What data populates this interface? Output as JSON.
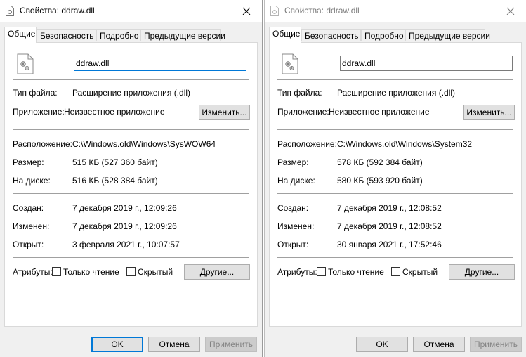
{
  "windows": [
    {
      "title": "Свойства: ddraw.dll",
      "tabs": [
        "Общие",
        "Безопасность",
        "Подробно",
        "Предыдущие версии"
      ],
      "file_name": "ddraw.dll",
      "file_type_label": "Тип файла:",
      "file_type_value": "Расширение приложения (.dll)",
      "app_label": "Приложение:",
      "app_value": "Неизвестное приложение",
      "change_button": "Изменить...",
      "location_label": "Расположение:",
      "location_value": "C:\\Windows.old\\Windows\\SysWOW64",
      "size_label": "Размер:",
      "size_value": "515 КБ (527 360 байт)",
      "disk_label": "На диске:",
      "disk_value": "516 КБ (528 384 байт)",
      "created_label": "Создан:",
      "created_value": "7 декабря 2019 г., 12:09:26",
      "modified_label": "Изменен:",
      "modified_value": "7 декабря 2019 г., 12:09:26",
      "opened_label": "Открыт:",
      "opened_value": "3 февраля 2021 г., 10:07:57",
      "attributes_label": "Атрибуты:",
      "readonly_label": "Только чтение",
      "hidden_label": "Скрытый",
      "other_button": "Другие...",
      "ok_button": "OK",
      "cancel_button": "Отмена",
      "apply_button": "Применить"
    },
    {
      "title": "Свойства: ddraw.dll",
      "tabs": [
        "Общие",
        "Безопасность",
        "Подробно",
        "Предыдущие версии"
      ],
      "file_name": "ddraw.dll",
      "file_type_label": "Тип файла:",
      "file_type_value": "Расширение приложения (.dll)",
      "app_label": "Приложение:",
      "app_value": "Неизвестное приложение",
      "change_button": "Изменить...",
      "location_label": "Расположение:",
      "location_value": "C:\\Windows.old\\Windows\\System32",
      "size_label": "Размер:",
      "size_value": "578 КБ (592 384 байт)",
      "disk_label": "На диске:",
      "disk_value": "580 КБ (593 920 байт)",
      "created_label": "Создан:",
      "created_value": "7 декабря 2019 г., 12:08:52",
      "modified_label": "Изменен:",
      "modified_value": "7 декабря 2019 г., 12:08:52",
      "opened_label": "Открыт:",
      "opened_value": "30 января 2021 г., 17:52:46",
      "attributes_label": "Атрибуты:",
      "readonly_label": "Только чтение",
      "hidden_label": "Скрытый",
      "other_button": "Другие...",
      "ok_button": "OK",
      "cancel_button": "Отмена",
      "apply_button": "Применить"
    }
  ],
  "icons": {
    "title": "dll-file-icon",
    "close": "close-icon",
    "file": "dll-file-gear-icon"
  },
  "colors": {
    "accent": "#0078d7",
    "dialog_bg": "#f0f0f0",
    "inactive_title": "#7a7a7a"
  }
}
